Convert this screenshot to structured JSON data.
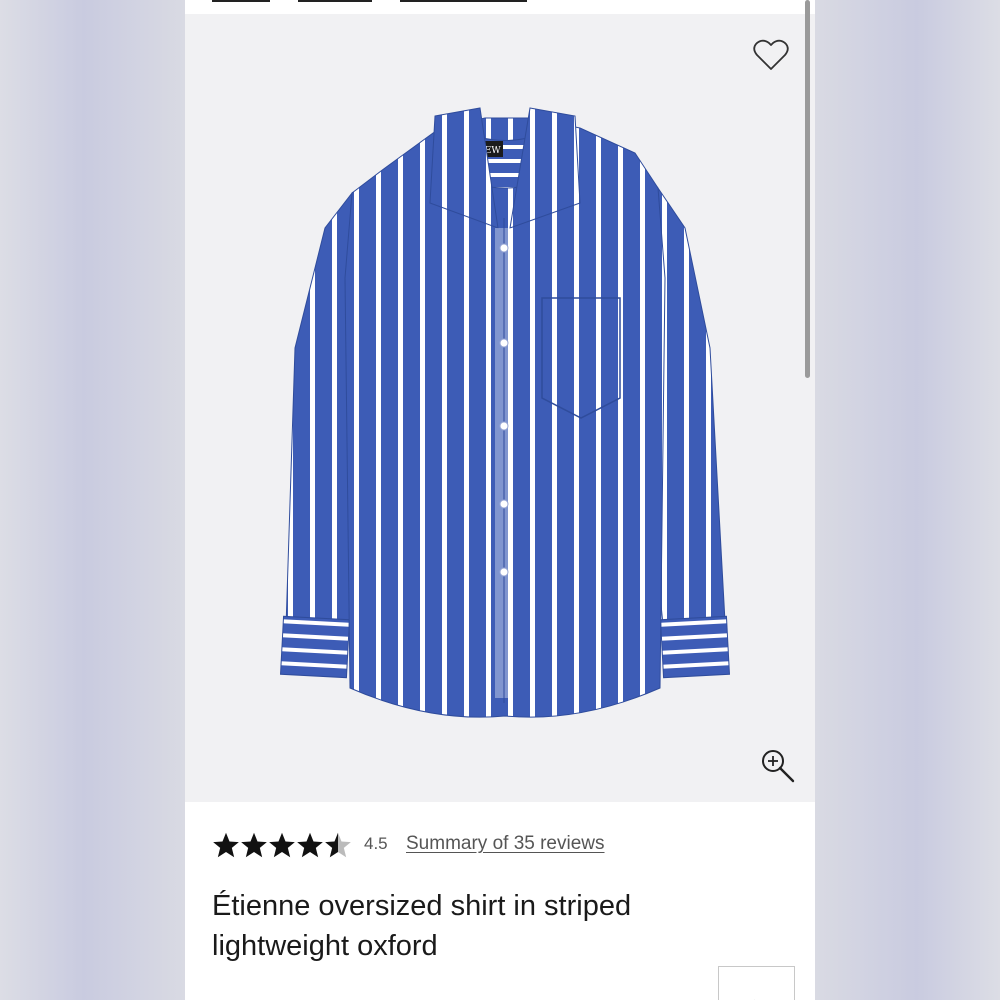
{
  "breadcrumb": {
    "items": [
      "",
      "",
      ""
    ]
  },
  "product": {
    "brand_label": "J.CREW",
    "rating_value": "4.5",
    "rating": 4.5,
    "reviews_link": "Summary of 35 reviews",
    "title_line1": "Étienne oversized shirt in striped",
    "title_line2": "lightweight oxford"
  },
  "icons": {
    "wishlist": "heart-icon",
    "zoom": "zoom-in-icon",
    "next": "chevron-right-icon"
  },
  "colors": {
    "shirt_blue": "#3b5fb8",
    "stripe": "#ffffff",
    "image_bg": "#f1f1f3"
  }
}
